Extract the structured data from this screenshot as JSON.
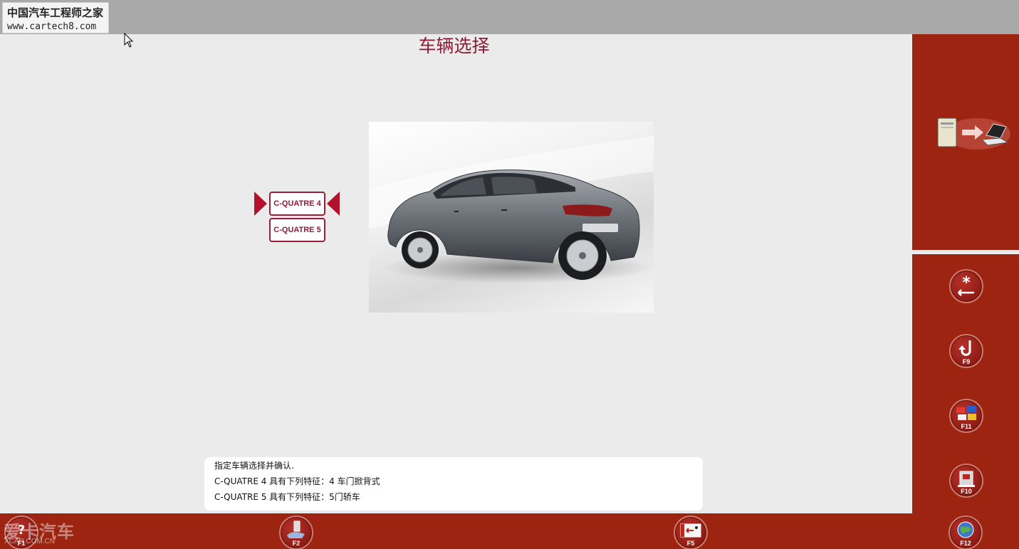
{
  "window": {
    "watermark_cn": "中国汽车工程师之家",
    "watermark_url": "www.cartech8.com",
    "bottom_logo": "爱卡汽车",
    "bottom_logo_sub": "XCAR.COM.CN"
  },
  "header": {
    "title": "车辆选择"
  },
  "vehicles": [
    {
      "label": "C-QUATRE 4",
      "selected": true
    },
    {
      "label": "C-QUATRE 5",
      "selected": false
    }
  ],
  "message": {
    "lines": [
      "指定车辆选择并确认.",
      "C-QUATRE 4 具有下列特征：4 车门掀背式",
      "C-QUATRE 5 具有下列特征：5门轿车"
    ]
  },
  "sidebar": {
    "transfer_icon": "pc-to-laptop-icon",
    "keys": [
      {
        "icon": "star-enter-icon",
        "label": ""
      },
      {
        "icon": "back-arrow-icon",
        "label": "F9"
      },
      {
        "icon": "flags-icon",
        "label": "F11"
      },
      {
        "icon": "tool-box-icon",
        "label": "F10"
      }
    ]
  },
  "bottombar": {
    "keys": [
      {
        "icon": "help-icon",
        "label": "F1"
      },
      {
        "icon": "hand-tool-icon",
        "label": "F2"
      },
      {
        "icon": "exit-icon",
        "label": "F5"
      },
      {
        "icon": "globe-icon",
        "label": "F12"
      }
    ]
  },
  "colors": {
    "accent": "#8e1b38",
    "sidebar_bg": "#9d2410",
    "content_bg": "#ebebeb",
    "topbar_bg": "#a9a9a9"
  }
}
